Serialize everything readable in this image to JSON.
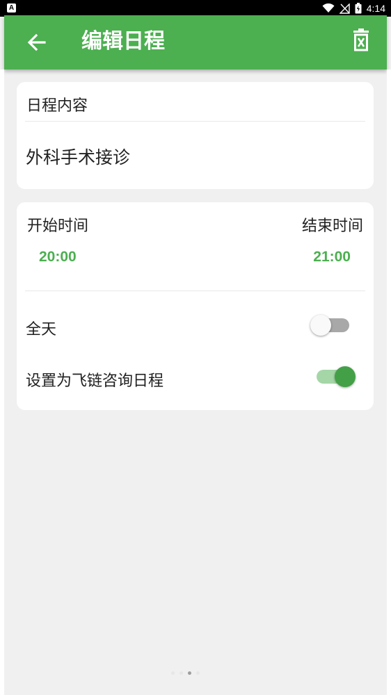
{
  "status_bar": {
    "notification_glyph": "A",
    "time": "4:14"
  },
  "app_bar": {
    "title": "编辑日程",
    "back_icon": "arrow-left-icon",
    "delete_icon": "delete-icon"
  },
  "schedule_content": {
    "label": "日程内容",
    "value": "外科手术接诊"
  },
  "time_range": {
    "start_label": "开始时间",
    "start_value": "20:00",
    "end_label": "结束时间",
    "end_value": "21:00"
  },
  "all_day": {
    "label": "全天",
    "enabled": false
  },
  "feilian_consult": {
    "label": "设置为飞链咨询日程",
    "enabled": true
  },
  "pager": {
    "page_count": 4,
    "active_index": 2
  },
  "colors": {
    "accent": "#4caf50",
    "switch_on_thumb": "#43a047",
    "background": "#f0f0f0"
  }
}
